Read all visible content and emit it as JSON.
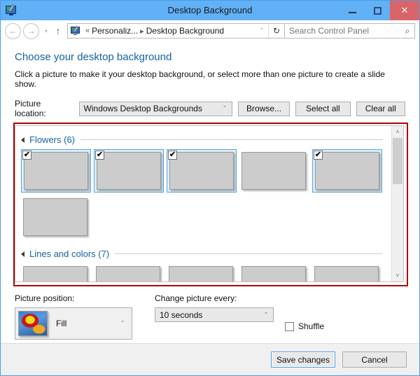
{
  "window": {
    "title": "Desktop Background",
    "app_icon": "desktop-background-icon",
    "controls": {
      "minimize": "minimize-icon",
      "maximize": "maximize-icon",
      "close": "close-icon",
      "close_glyph": "✕",
      "close_color": "#d9656a"
    },
    "titlebar_color": "#62b0f6"
  },
  "addressbar": {
    "back": "←",
    "forward": "→",
    "history_caret": "▾",
    "up": "↑",
    "breadcrumb": {
      "icon": "control-panel-icon",
      "leading_sep": "«",
      "parent": "Personaliz...",
      "separator": "▸",
      "current": "Desktop Background",
      "dropdown": "ˇ"
    },
    "refresh": "↻",
    "search": {
      "placeholder": "Search Control Panel",
      "value": "",
      "icon": "⌕"
    }
  },
  "page": {
    "heading": "Choose your desktop background",
    "heading_color": "#1463a5",
    "subtitle": "Click a picture to make it your desktop background, or select more than one picture to create a slide show."
  },
  "picture_location": {
    "label": "Picture location:",
    "selected": "Windows Desktop Backgrounds",
    "arrow": "ˇ",
    "buttons": {
      "browse": "Browse...",
      "select_all": "Select all",
      "clear_all": "Clear all"
    }
  },
  "gallery": {
    "highlight_color": "#b00000",
    "scrollbar": {
      "up": "˄",
      "down": "˅",
      "thumb_position_pct": 0
    },
    "groups": [
      {
        "label": "Flowers (6)",
        "expander": "collapse-triangle-icon",
        "items": [
          {
            "name": "flower-1",
            "selected": true,
            "check": "✔",
            "css": "img-f1"
          },
          {
            "name": "flower-2",
            "selected": true,
            "check": "✔",
            "css": "img-f2"
          },
          {
            "name": "flower-3",
            "selected": true,
            "check": "✔",
            "css": "img-f3"
          },
          {
            "name": "flower-4",
            "selected": false,
            "check": "",
            "css": "img-f4"
          },
          {
            "name": "flower-5",
            "selected": true,
            "check": "✔",
            "css": "img-f5"
          },
          {
            "name": "flower-6",
            "selected": false,
            "check": "",
            "css": "img-f6"
          }
        ]
      },
      {
        "label": "Lines and colors (7)",
        "expander": "collapse-triangle-icon",
        "items": [
          {
            "name": "lines-1",
            "selected": false,
            "check": "",
            "css": "img-l1"
          },
          {
            "name": "lines-2",
            "selected": false,
            "check": "",
            "css": "img-l2"
          },
          {
            "name": "lines-3",
            "selected": false,
            "check": "",
            "css": "img-l3"
          },
          {
            "name": "lines-4",
            "selected": false,
            "check": "",
            "css": "img-l4"
          },
          {
            "name": "lines-5",
            "selected": false,
            "check": "",
            "css": "img-l5"
          }
        ]
      }
    ]
  },
  "picture_position": {
    "label": "Picture position:",
    "selected": "Fill",
    "arrow": "ˇ",
    "preview": "fill-preview-thumbnail"
  },
  "change_picture": {
    "label": "Change picture every:",
    "selected": "10 seconds",
    "arrow": "ˇ"
  },
  "shuffle": {
    "label": "Shuffle",
    "checked": false
  },
  "footer": {
    "save": "Save changes",
    "cancel": "Cancel"
  }
}
